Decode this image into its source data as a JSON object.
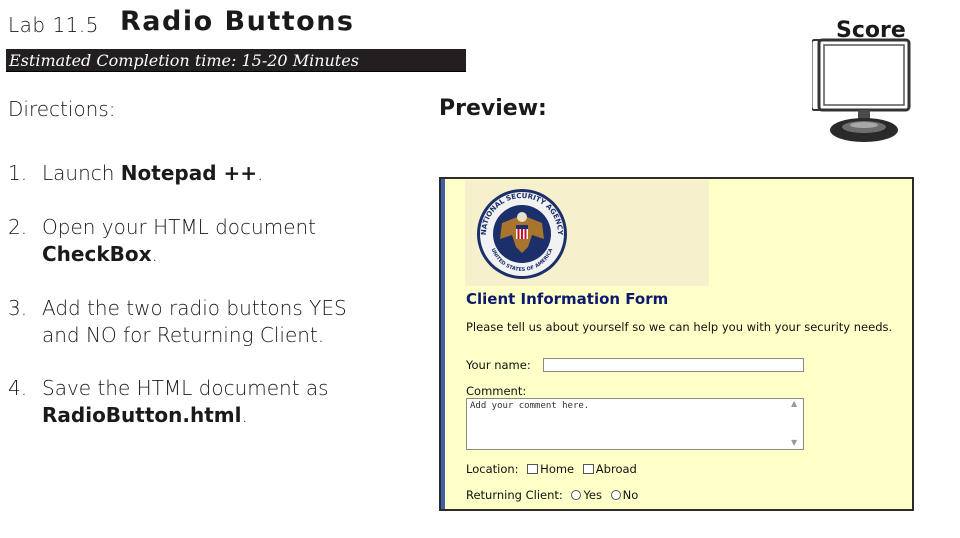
{
  "header": {
    "lab_number": "Lab 11.5",
    "lab_title": "Radio Buttons",
    "time_estimate": "Estimated Completion time: 15-20 Minutes"
  },
  "score": {
    "label": "Score"
  },
  "directions": {
    "label": "Directions:",
    "steps": [
      {
        "num": "1.",
        "pre": "Launch ",
        "bold": "Notepad ++",
        "post": "."
      },
      {
        "num": "2.",
        "pre": "Open your HTML document",
        "bold": "CheckBox",
        "post": "."
      },
      {
        "num": "3.",
        "line1": "Add the two radio buttons YES",
        "line2": "and NO for Returning Client."
      },
      {
        "num": "4.",
        "pre": "Save the HTML document as",
        "bold": "RadioButton.html",
        "post": "."
      }
    ]
  },
  "preview": {
    "label": "Preview:",
    "logo": {
      "top_text": "NATIONAL SECURITY AGENCY",
      "bottom_text": "UNITED STATES OF AMERICA"
    },
    "form_title": "Client Information Form",
    "intro": "Please tell us about yourself so we can help you with your security needs.",
    "name_label": "Your name:",
    "name_value": "",
    "comment_label": "Comment:",
    "comment_placeholder": "Add your comment here.",
    "location_label": "Location:",
    "location_options": [
      "Home",
      "Abroad"
    ],
    "returning_label": "Returning Client:",
    "returning_options": [
      "Yes",
      "No"
    ]
  },
  "colors": {
    "time_bar": "#231f20",
    "preview_background": "#ffffc8",
    "form_title": "#0c1a6e",
    "frame_accent": "#3f5fa8"
  }
}
